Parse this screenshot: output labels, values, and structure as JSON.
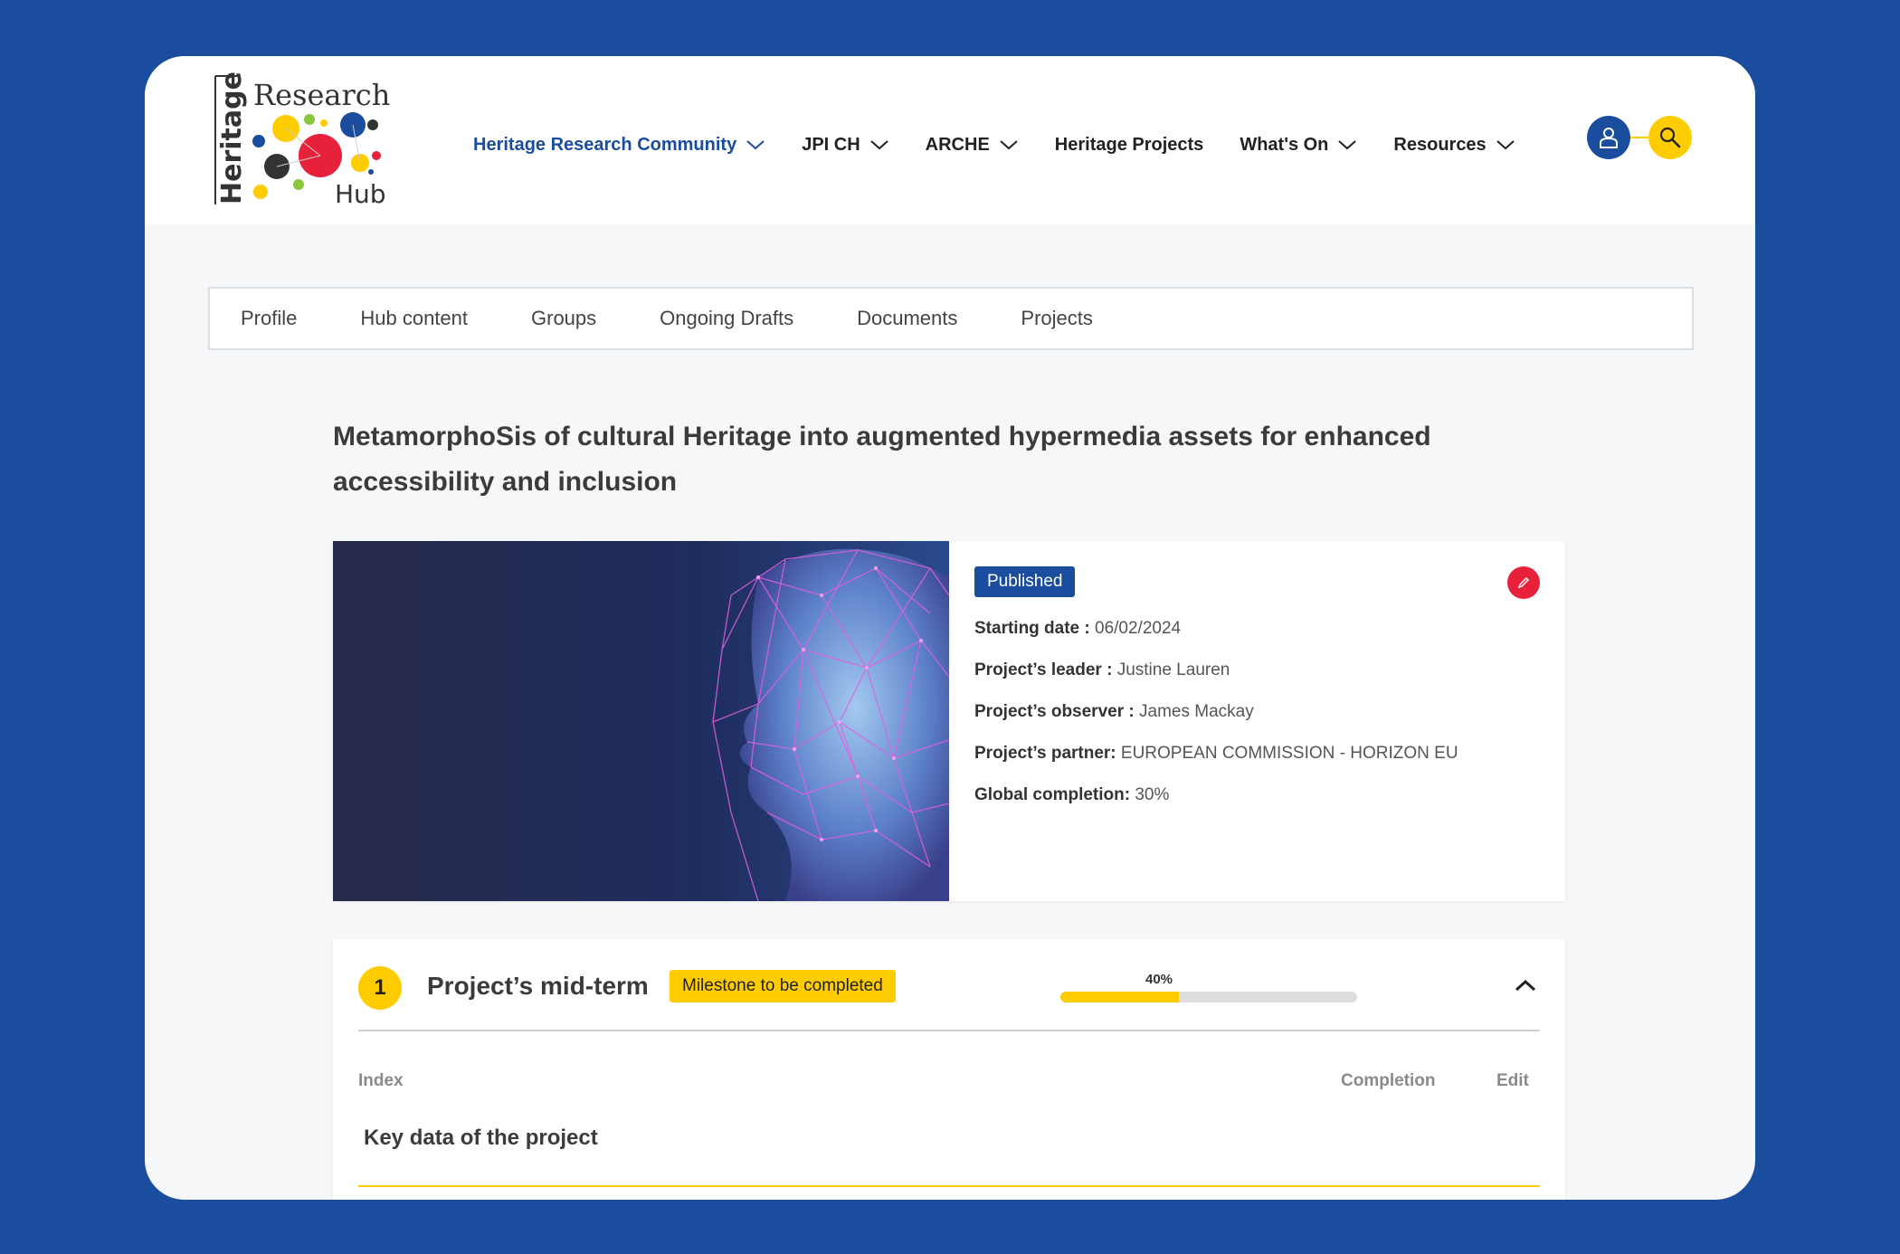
{
  "logo": {
    "word_top": "Research",
    "word_side": "Heritage",
    "word_bottom": "Hub"
  },
  "nav": {
    "items": [
      {
        "label": "Heritage Research Community",
        "has_dropdown": true,
        "active": true
      },
      {
        "label": "JPI CH",
        "has_dropdown": true,
        "active": false
      },
      {
        "label": "ARCHE",
        "has_dropdown": true,
        "active": false
      },
      {
        "label": "Heritage Projects",
        "has_dropdown": false,
        "active": false
      },
      {
        "label": "What's On",
        "has_dropdown": true,
        "active": false
      },
      {
        "label": "Resources",
        "has_dropdown": true,
        "active": false
      }
    ],
    "user_icon": "user-icon",
    "search_icon": "search-icon"
  },
  "tabs": [
    "Profile",
    "Hub content",
    "Groups",
    "Ongoing Drafts",
    "Documents",
    "Projects"
  ],
  "project": {
    "title": "MetamorphoSis of cultural Heritage into augmented hypermedia assets for enhanced accessibility and inclusion",
    "status": "Published",
    "fields": [
      {
        "label": "Starting date :",
        "value": " 06/02/2024"
      },
      {
        "label": "Project’s leader :",
        "value": " Justine Lauren"
      },
      {
        "label": "Project’s observer :",
        "value": " James Mackay"
      },
      {
        "label": "Project’s partner:",
        "value": " EUROPEAN COMMISSION - HORIZON EU"
      },
      {
        "label": "Global completion:",
        "value": " 30%"
      }
    ]
  },
  "milestone": {
    "number": "1",
    "title": "Project’s mid-term",
    "badge": "Milestone to be completed",
    "progress_label": "40%",
    "progress": 0.4,
    "columns": {
      "index": "Index",
      "completion": "Completion",
      "edit": "Edit"
    },
    "rows": [
      {
        "title": "Key data of the project"
      }
    ]
  },
  "colors": {
    "brand_blue": "#1a4d9e",
    "accent_yellow": "#ffcc00",
    "edit_red": "#e8213b"
  }
}
